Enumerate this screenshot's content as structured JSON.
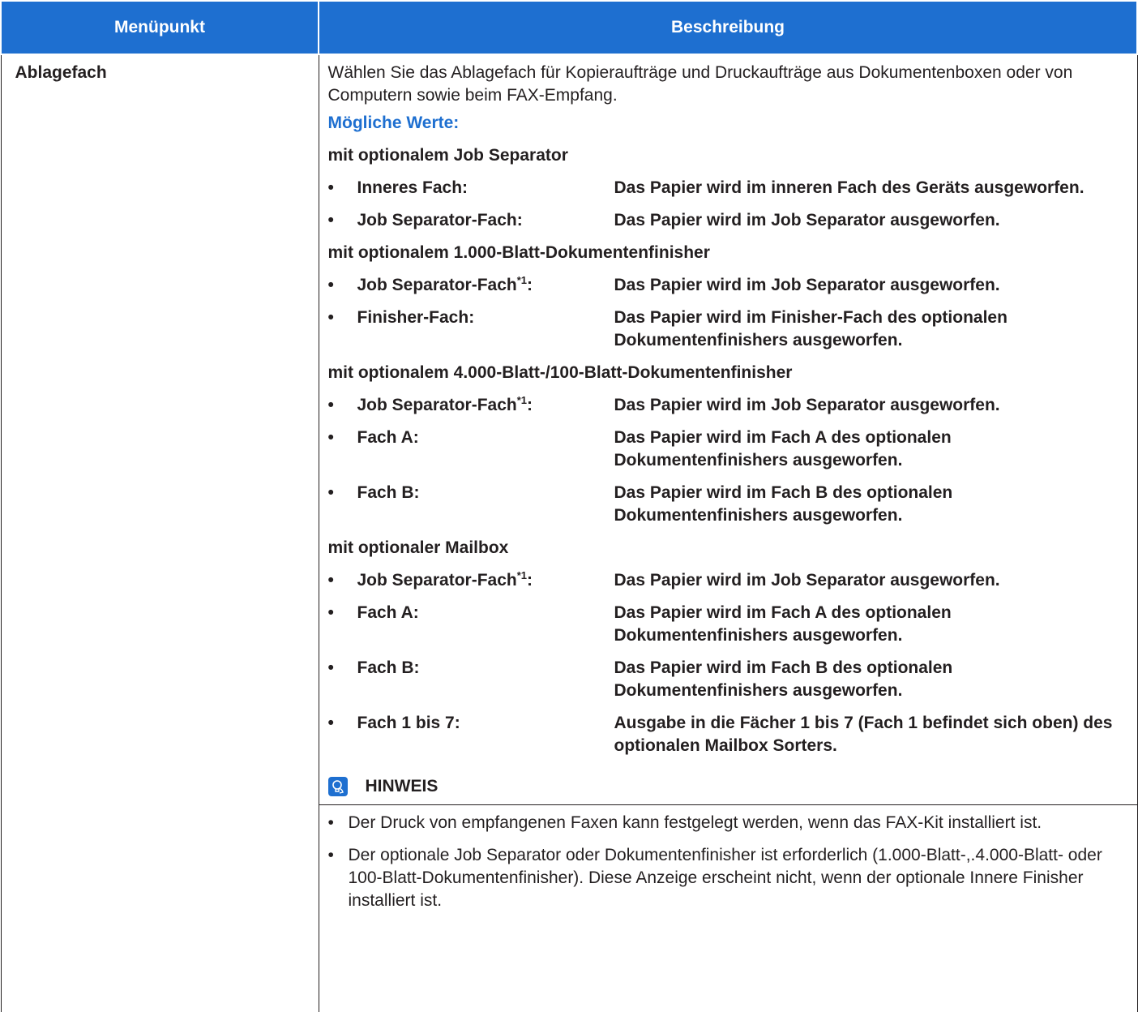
{
  "header": {
    "col1": "Menüpunkt",
    "col2": "Beschreibung"
  },
  "item": "Ablagefach",
  "intro": "Wählen Sie das Ablagefach für Kopieraufträge und Druckaufträge aus Dokumentenboxen oder von Computern sowie beim FAX-Empfang.",
  "values_label": "Mögliche Werte:",
  "bullet": "•",
  "footnote_mark": "*1",
  "groups": {
    "g1": {
      "title": "mit optionalem Job Separator",
      "o1": {
        "name": "Inneres Fach:",
        "desc": "Das Papier wird im inneren Fach des Geräts ausgeworfen."
      },
      "o2": {
        "name": "Job Separator-Fach:",
        "desc": "Das Papier wird im Job Separator ausgeworfen."
      }
    },
    "g2": {
      "title": "mit optionalem 1.000-Blatt-Dokumentenfinisher",
      "o1": {
        "name": "Job Separator-Fach",
        "desc": "Das Papier wird im Job Separator ausgeworfen."
      },
      "o2": {
        "name": "Finisher-Fach:",
        "desc": "Das Papier wird im Finisher-Fach des optionalen Dokumentenfinishers ausgeworfen."
      }
    },
    "g3": {
      "title": "mit optionalem 4.000-Blatt-/100-Blatt-Dokumentenfinisher",
      "o1": {
        "name": "Job Separator-Fach",
        "desc": "Das Papier wird im Job Separator ausgeworfen."
      },
      "o2": {
        "name": "Fach A:",
        "desc": "Das Papier wird im Fach A des optionalen Dokumentenfinishers ausgeworfen."
      },
      "o3": {
        "name": "Fach B:",
        "desc": "Das Papier wird im Fach B des optionalen Dokumentenfinishers ausgeworfen."
      }
    },
    "g4": {
      "title": "mit optionaler Mailbox",
      "o1": {
        "name": "Job Separator-Fach",
        "desc": "Das Papier wird im Job Separator ausgeworfen."
      },
      "o2": {
        "name": "Fach A:",
        "desc": "Das Papier wird im Fach A des optionalen Dokumentenfinishers ausgeworfen."
      },
      "o3": {
        "name": "Fach B:",
        "desc": "Das Papier wird im Fach B des optionalen Dokumentenfinishers ausgeworfen."
      },
      "o4": {
        "name": "Fach 1 bis 7:",
        "desc": "Ausgabe in die Fächer 1 bis 7 (Fach 1 befindet sich oben) des optionalen Mailbox Sorters."
      }
    }
  },
  "note": {
    "title": "HINWEIS",
    "icon": "lightbulb-hand-icon",
    "items": [
      "Der Druck von empfangenen Faxen kann festgelegt werden, wenn das FAX-Kit installiert ist.",
      "Der optionale Job Separator oder Dokumentenfinisher ist erforderlich (1.000-Blatt-,.4.000-Blatt- oder 100-Blatt-Dokumentenfinisher). Diese Anzeige erscheint nicht, wenn der optionale Innere Finisher installiert ist."
    ]
  },
  "colors": {
    "header_bg": "#1e6fd0",
    "accent": "#1e6fd0"
  }
}
